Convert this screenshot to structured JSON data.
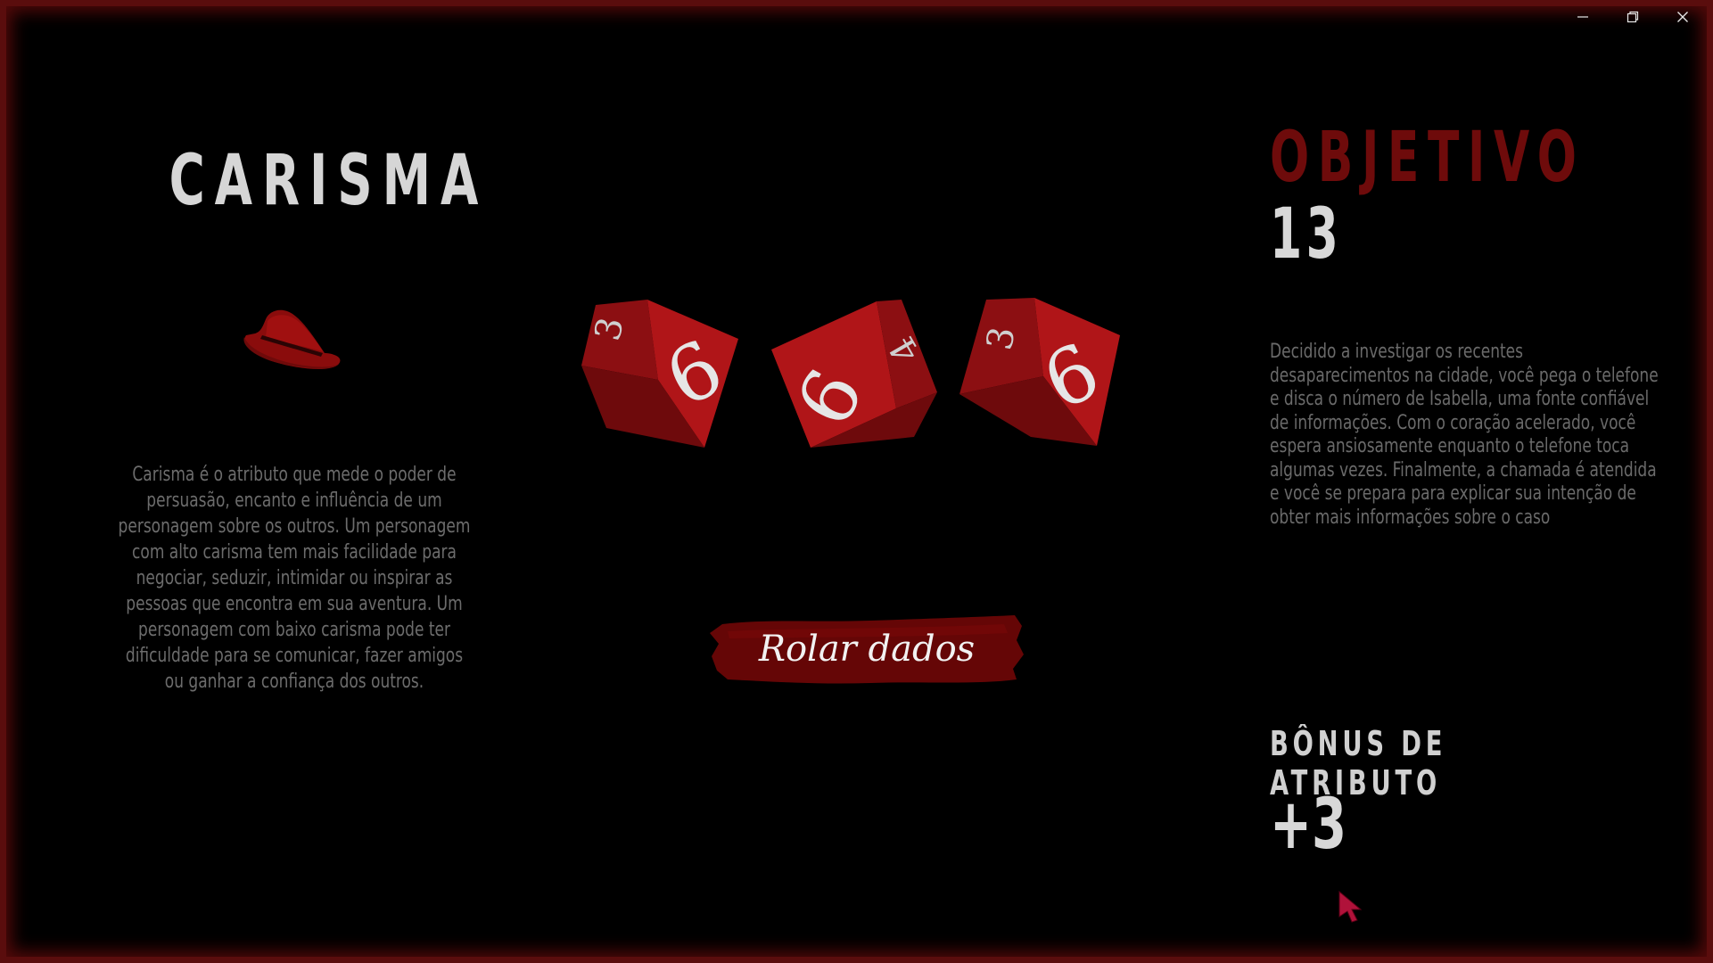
{
  "window": {
    "minimize": "—",
    "restore": "❐",
    "close": "✕"
  },
  "attribute": {
    "name": "CARISMA",
    "icon": "fedora-hat-icon",
    "description": "Carisma é o atributo que mede o poder de persuasão, encanto e influência de um personagem sobre os outros. Um personagem com alto carisma tem mais facilidade para negociar, seduzir, intimidar ou inspirar as pessoas que encontra em sua aventura. Um personagem com baixo carisma pode ter dificuldade para se comunicar, fazer amigos ou ganhar a confiança dos outros."
  },
  "dice": [
    {
      "top_face": 6,
      "side_face": 3
    },
    {
      "top_face": 6,
      "side_face": 4
    },
    {
      "top_face": 6,
      "side_face": 3
    }
  ],
  "roll_button": {
    "label": "Rolar dados"
  },
  "objective": {
    "title": "OBJETIVO",
    "value": "13",
    "story": "Decidido a investigar os recentes desaparecimentos na cidade, você pega o telefone e disca o número de Isabella, uma fonte confiável de informações. Com o coração acelerado, você espera ansiosamente enquanto o telefone toca algumas vezes. Finalmente, a chamada é atendida e você se prepara para explicar sua intenção de obter mais informações sobre o caso"
  },
  "bonus": {
    "title": "BÔNUS DE ATRIBUTO",
    "value": "+3"
  },
  "colors": {
    "accent": "#6e0b0b",
    "die": "#a01214",
    "frame": "#5a0d0d",
    "cursor": "#b0123a"
  }
}
